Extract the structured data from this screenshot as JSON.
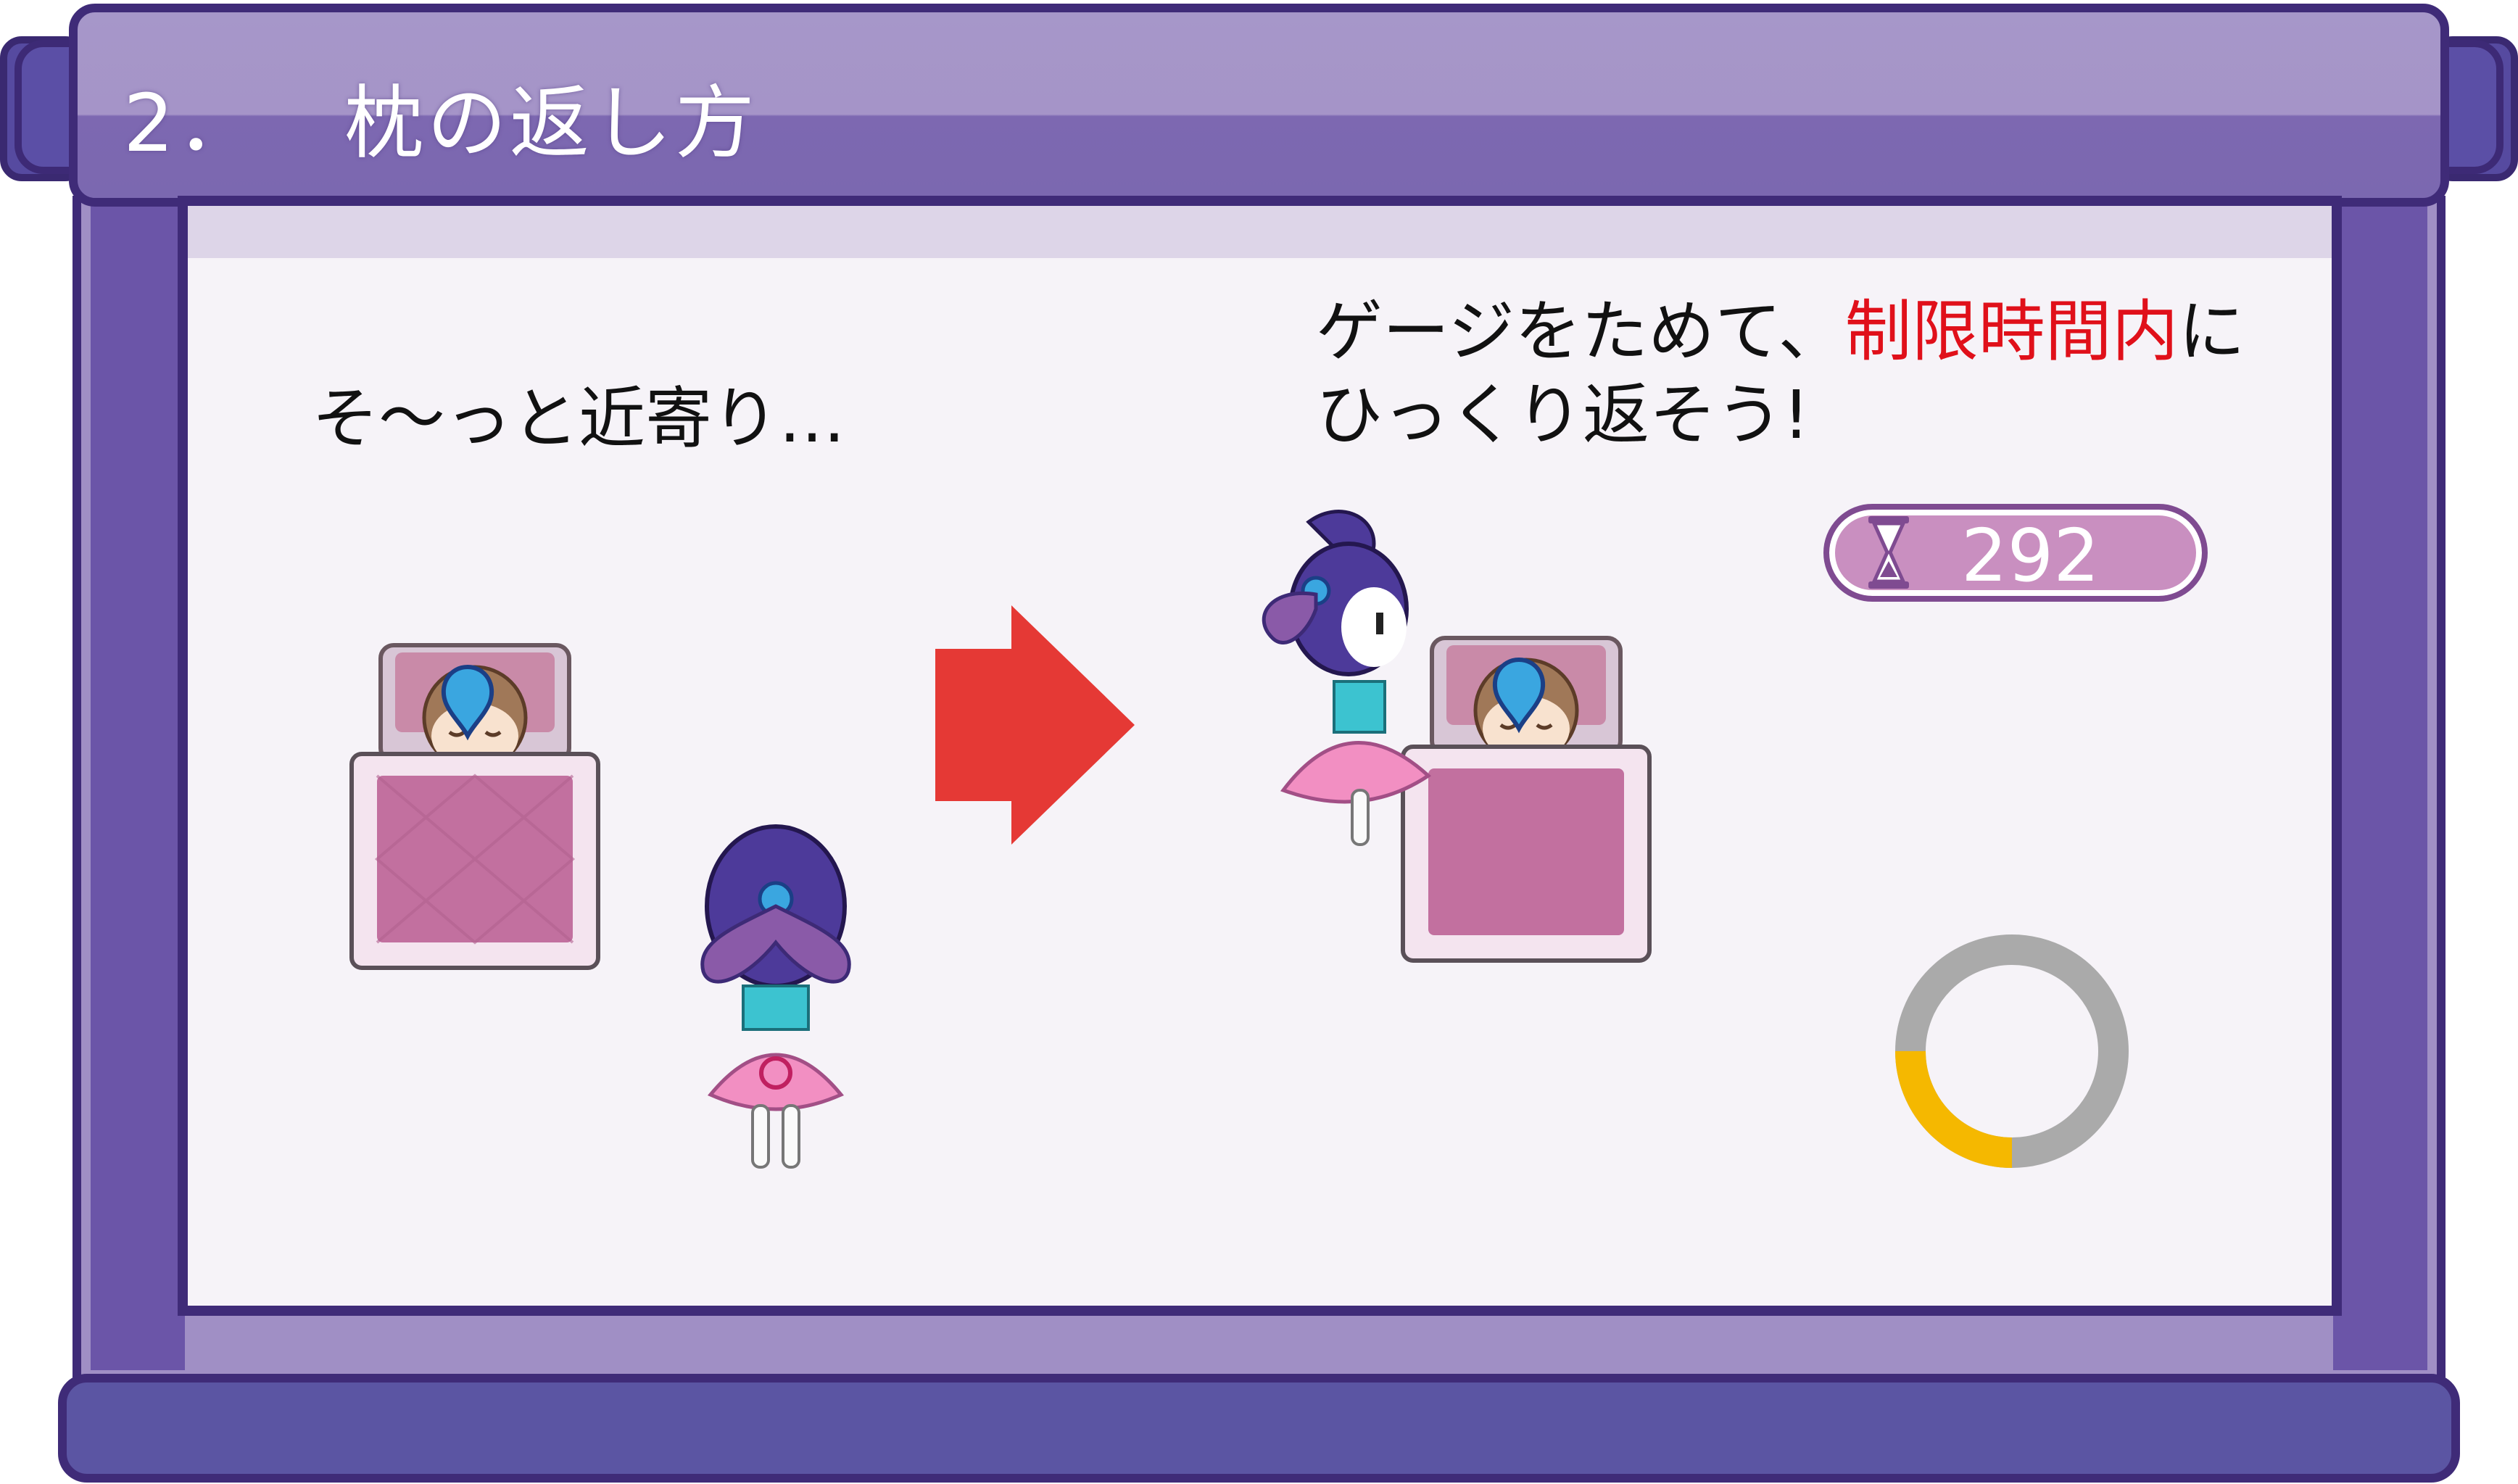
{
  "title": {
    "number": "2．",
    "text": "枕の返し方"
  },
  "captions": {
    "left": "そ〜っと近寄り…",
    "right_line1_pre": "ゲージをためて、",
    "right_line1_emph": "制限時間内",
    "right_line1_post": "に",
    "right_line2": "ひっくり返そう!"
  },
  "timer": {
    "icon": "hourglass-icon",
    "value": "292"
  },
  "gauge": {
    "fill_fraction": 0.25,
    "fill_color": "#f5b800",
    "track_color": "#aaaaaa"
  },
  "arrow": {
    "icon": "arrow-right-icon",
    "color": "#e53935"
  },
  "colors": {
    "frame_dark": "#3f2b78",
    "frame_mid": "#a08fc5",
    "emphasis": "#e0101a"
  }
}
